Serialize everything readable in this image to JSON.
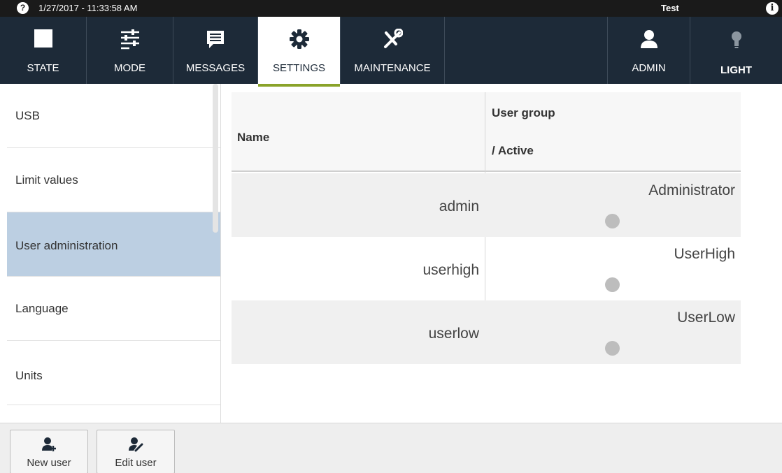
{
  "status_bar": {
    "help_glyph": "?",
    "datetime": "1/27/2017 - 11:33:58 AM",
    "username": "Test",
    "info_glyph": "i"
  },
  "nav": {
    "tabs": [
      {
        "label": "STATE",
        "icon": "square-icon"
      },
      {
        "label": "MODE",
        "icon": "sliders-icon"
      },
      {
        "label": "MESSAGES",
        "icon": "message-icon"
      },
      {
        "label": "SETTINGS",
        "icon": "gear-icon",
        "active": true
      },
      {
        "label": "MAINTENANCE",
        "icon": "tools-icon"
      }
    ],
    "admin_label": "ADMIN",
    "light_label": "LIGHT"
  },
  "sidebar": {
    "items": [
      {
        "label": "USB"
      },
      {
        "label": "Limit values"
      },
      {
        "label": "User administration",
        "selected": true
      },
      {
        "label": "Language"
      },
      {
        "label": "Units"
      }
    ]
  },
  "table": {
    "headers": {
      "name": "Name",
      "group_line1": "User group",
      "group_line2": "/ Active"
    },
    "rows": [
      {
        "name": "admin",
        "group": "Administrator",
        "active": false
      },
      {
        "name": "userhigh",
        "group": "UserHigh",
        "active": false
      },
      {
        "name": "userlow",
        "group": "UserLow",
        "active": false
      }
    ]
  },
  "toolbar": {
    "new_user_label": "New user",
    "edit_user_label": "Edit user"
  },
  "colors": {
    "nav_background": "#1d2a38",
    "selected_item": "#bccfe2",
    "tab_underline": "#8aa32a",
    "active_dot": "#bdbdbd"
  }
}
